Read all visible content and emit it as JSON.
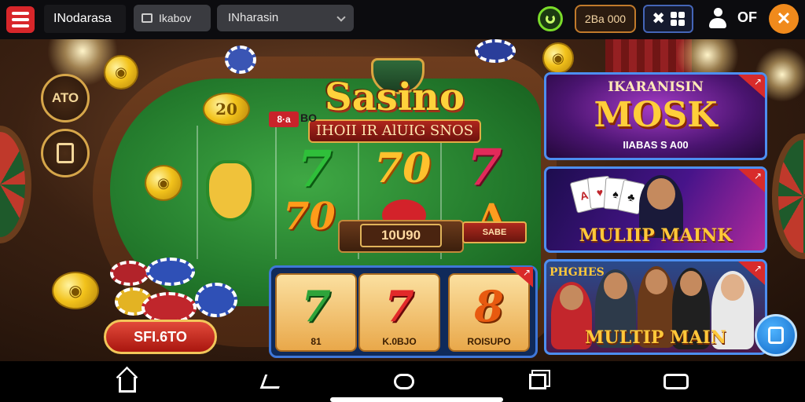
{
  "topbar": {
    "brand": "INodarasa",
    "tab_label": "Ikabov",
    "select_value": "INharasin",
    "balance": "2Ba 000",
    "user_label": "OF"
  },
  "left": {
    "round_button_1": "ATO",
    "bet_button": "SFI.6TO"
  },
  "coins": [
    "20"
  ],
  "logo": {
    "title": "Sasino",
    "ribbon": "IHOII IR AlUIG SNOS"
  },
  "felt": {
    "tag_red": "8·a",
    "tag_dark": "BO",
    "symbols": [
      "7",
      "70",
      "7",
      "70",
      "A"
    ],
    "bet_amount": "10U90",
    "mini_banner": "SABE"
  },
  "slots": [
    {
      "symbol": "7",
      "label": "81"
    },
    {
      "symbol": "7",
      "label": "K.0BJO"
    },
    {
      "symbol": "8",
      "label": "ROISUPO"
    }
  ],
  "promos": [
    {
      "subtitle": "IKARANISIN",
      "title": "MOSK",
      "caption": "IIABAS S A00"
    },
    {
      "title": "MULIIP MAINK"
    },
    {
      "subtitle": "PHGHES",
      "title": "MULTIP MAIN"
    }
  ],
  "colors": {
    "felt_green": "#237a2c",
    "accent_gold": "#f2c21b",
    "promo_border": "#4d8ef0",
    "bet_red": "#c9232a"
  }
}
